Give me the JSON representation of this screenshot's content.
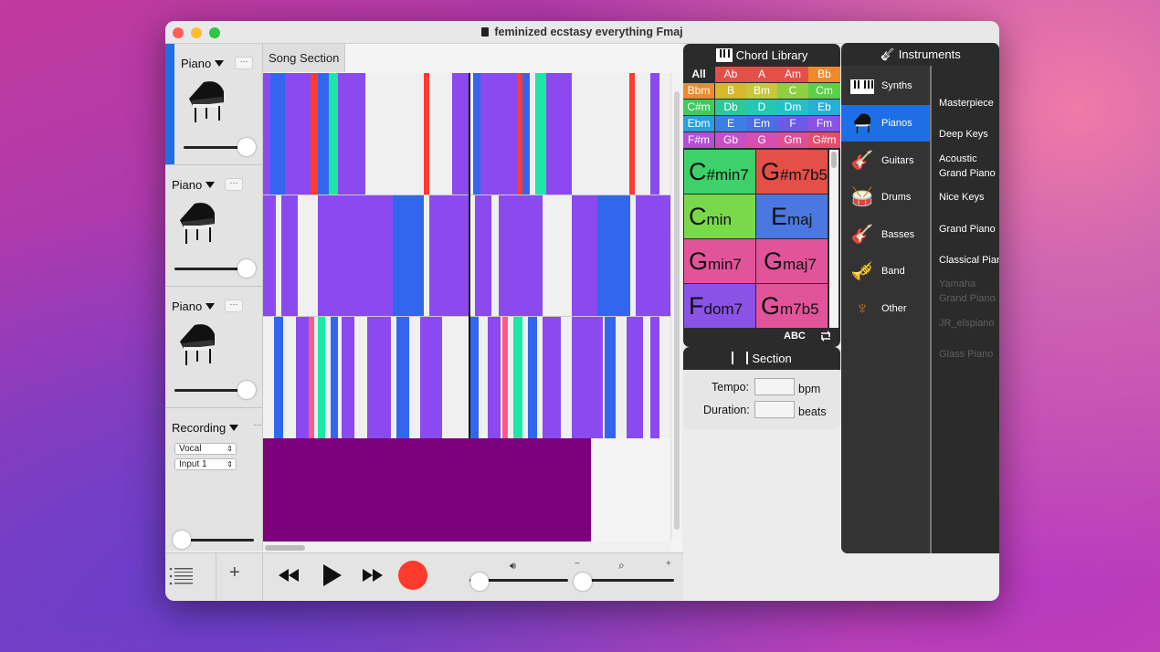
{
  "window": {
    "title": "feminized ecstasy everything Fmaj"
  },
  "tracks": [
    {
      "name": "Piano",
      "volume": 1.0
    },
    {
      "name": "Piano",
      "volume": 1.0
    },
    {
      "name": "Piano",
      "volume": 1.0
    }
  ],
  "recording": {
    "name": "Recording",
    "type": "Vocal",
    "input": "Input 1",
    "volume": 0.0
  },
  "track_more": "···",
  "song_section": {
    "label": "Song Section"
  },
  "chord_library": {
    "title": "Chord Library",
    "filters": [
      [
        "All",
        "Ab",
        "A",
        "Am",
        "Bb"
      ],
      [
        "Bbm",
        "B",
        "Bm",
        "C",
        "Cm"
      ],
      [
        "C#m",
        "Db",
        "D",
        "Dm",
        "Eb"
      ],
      [
        "Ebm",
        "E",
        "Em",
        "F",
        "Fm"
      ],
      [
        "F#m",
        "Gb",
        "G",
        "Gm",
        "G#m"
      ]
    ],
    "chords": [
      {
        "root": "C",
        "quality": "#min7",
        "color": "#3ed06a"
      },
      {
        "root": "G",
        "quality": "#m7b5",
        "color": "#e35048"
      },
      {
        "root": "C",
        "quality": "min",
        "color": "#7ad94b"
      },
      {
        "root": "E",
        "quality": "maj",
        "color": "#4a78e0"
      },
      {
        "root": "G",
        "quality": "min7",
        "color": "#e2549a"
      },
      {
        "root": "G",
        "quality": "maj7",
        "color": "#e2549a"
      },
      {
        "root": "F",
        "quality": "dom7",
        "color": "#8a52e6"
      },
      {
        "root": "G",
        "quality": "m7b5",
        "color": "#e2549a"
      }
    ],
    "abc_label": "ABC"
  },
  "section": {
    "title": "Section",
    "tempo_label": "Tempo:",
    "tempo_value": "",
    "tempo_unit": "bpm",
    "duration_label": "Duration:",
    "duration_value": "",
    "duration_unit": "beats"
  },
  "instruments": {
    "title": "Instruments",
    "categories": [
      {
        "label": "Synths",
        "icon": "keyboard-icon"
      },
      {
        "label": "Pianos",
        "icon": "grand-piano-icon",
        "selected": true
      },
      {
        "label": "Guitars",
        "icon": "guitar-icon"
      },
      {
        "label": "Drums",
        "icon": "drums-icon"
      },
      {
        "label": "Basses",
        "icon": "bass-icon"
      },
      {
        "label": "Band",
        "icon": "tuba-icon"
      },
      {
        "label": "Other",
        "icon": "harp-icon"
      }
    ],
    "presets": [
      {
        "label": "Masterpiece",
        "enabled": true
      },
      {
        "label": "Deep Keys",
        "enabled": true
      },
      {
        "label": "Acoustic Grand Piano",
        "enabled": true
      },
      {
        "label": "Nice Keys",
        "enabled": true
      },
      {
        "label": "Grand Piano",
        "enabled": true
      },
      {
        "label": "Classical Piano",
        "enabled": true
      },
      {
        "label": "Yamaha Grand Piano",
        "enabled": false
      },
      {
        "label": "JR_elspiano",
        "enabled": false
      },
      {
        "label": "Glass Piano",
        "enabled": false
      }
    ]
  },
  "transport": {
    "volume": 0.03,
    "zoom": 0.06,
    "zoom_minus": "−",
    "zoom_plus": "+"
  },
  "bottom": {
    "add_label": "+"
  },
  "colors": {
    "accent": "#1e6fe6",
    "record": "#ff3b30",
    "recording_region": "#7c007c",
    "purple": "#8a4af0",
    "blue": "#3366ee",
    "red": "#ff3b30",
    "mint": "#1ee6a8",
    "white": "#f0f0f0"
  }
}
